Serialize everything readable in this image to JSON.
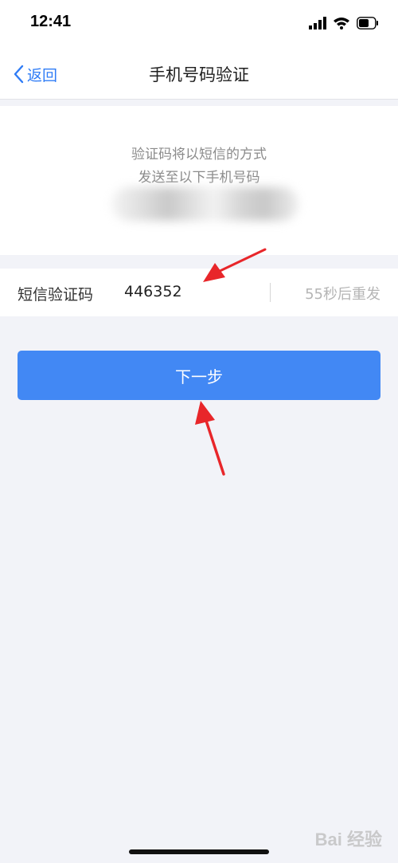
{
  "status_bar": {
    "time": "12:41"
  },
  "nav": {
    "back_label": "返回",
    "title": "手机号码验证"
  },
  "info": {
    "line1": "验证码将以短信的方式",
    "line2": "发送至以下手机号码"
  },
  "code_row": {
    "label": "短信验证码",
    "value": "446352",
    "resend": "55秒后重发"
  },
  "next_button": {
    "label": "下一步"
  },
  "watermark": {
    "text": "Bai 经验"
  },
  "colors": {
    "accent": "#4288f4",
    "link": "#2f7cf6",
    "background": "#f2f3f8",
    "annotation_arrow": "#e8262a"
  }
}
